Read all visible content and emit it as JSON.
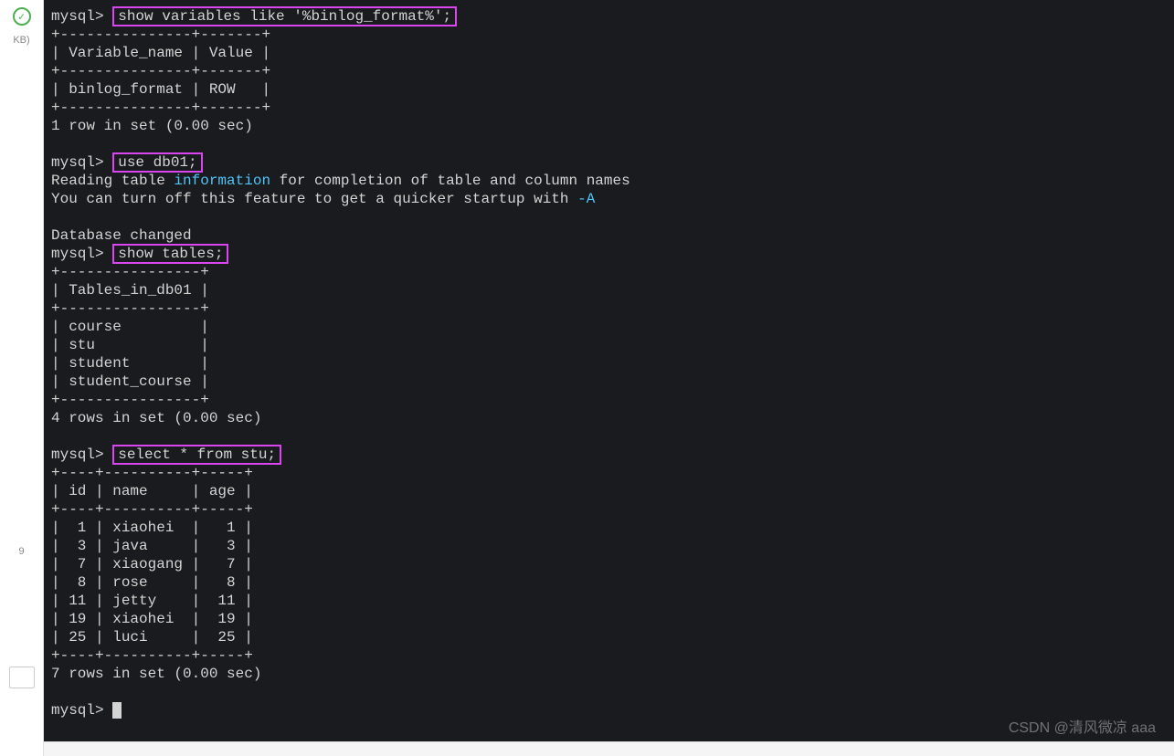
{
  "left": {
    "kb_label": "KB)",
    "num": "9"
  },
  "terminal": {
    "prompt": "mysql>",
    "cmd1": "show variables like '%binlog_format%';",
    "sep1": "+---------------+-------+",
    "header_line": "| Variable_name | Value |",
    "data_line": "| binlog_format | ROW   |",
    "result1": "1 row in set (0.00 sec)",
    "cmd2": "use db01;",
    "reading_pre": "Reading table ",
    "reading_info": "information",
    "reading_post": " for completion of table and column names",
    "turnoff_pre": "You can turn off this feature to get a quicker startup with ",
    "turnoff_flag": "-A",
    "db_changed": "Database changed",
    "cmd3": "show tables;",
    "tables_sep": "+----------------+",
    "tables_header": "| Tables_in_db01 |",
    "tables": [
      "| course         |",
      "| stu            |",
      "| student        |",
      "| student_course |"
    ],
    "result3": "4 rows in set (0.00 sec)",
    "cmd4": "select * from stu;",
    "stu_sep": "+----+----------+-----+",
    "stu_header": "| id | name     | age |",
    "stu_rows": [
      "|  1 | xiaohei  |   1 |",
      "|  3 | java     |   3 |",
      "|  7 | xiaogang |   7 |",
      "|  8 | rose     |   8 |",
      "| 11 | jetty    |  11 |",
      "| 19 | xiaohei  |  19 |",
      "| 25 | luci     |  25 |"
    ],
    "result4": "7 rows in set (0.00 sec)"
  },
  "watermark": "CSDN @清风微凉 aaa"
}
